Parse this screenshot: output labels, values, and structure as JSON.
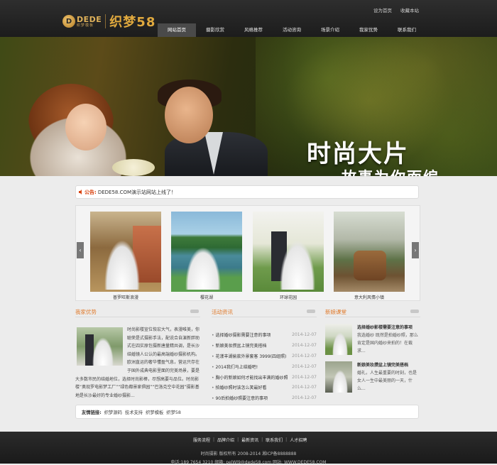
{
  "header": {
    "logo": {
      "mark": "D",
      "dede": "DEDE",
      "dede_cn": "织梦模板",
      "brand_cn": "织梦58"
    },
    "top_links": [
      "设为首页",
      "收藏本站"
    ],
    "nav": [
      "网站首页",
      "摄影欣赏",
      "风格推荐",
      "活动咨询",
      "场景介绍",
      "我家优势",
      "联系我们"
    ]
  },
  "banner": {
    "title": "时尚大片",
    "subtitle": "故事为你而编"
  },
  "notice": {
    "label": "公告:",
    "text": "DEDE58.COM演示站网站上线了！"
  },
  "carousel": {
    "left_arrow": "‹",
    "right_arrow": "›",
    "photos": [
      {
        "caption": "普罗旺斯浪漫"
      },
      {
        "caption": "樱花湖"
      },
      {
        "caption": "环球花园"
      },
      {
        "caption": "意大利风情小镇"
      }
    ]
  },
  "advantage": {
    "title": "我家优势",
    "text": "时尚影楼宣位恢宏大气，表漫唯美，你聪荣是式摄影手法，配说合自演新胖助式在四实原包摄新唐量精共调，是长沙结婚镜人公认的最高端婚纱摄影机构。欧洲直运的奢华懂盈气息，营运只存在于国外成典电影里面的完美场景，要是大多数市民的结婚地位，选择时尚影棒，尽想高要与品位。时尚影楼“奥现罗电影梦工厂”“绿色都景家俱园”“巴洛克空中花园”摄影基地是长沙最好的专业婚纱摄影..."
  },
  "activity": {
    "title": "活动资讯",
    "items": [
      {
        "title": "选择婚纱摄影需要注意的事项",
        "date": "2014-12-07"
      },
      {
        "title": "新娘美妆攒盆上镜完美搭档",
        "date": "2014-12-07"
      },
      {
        "title": "花漾丰湖偷款外景套客 3999(四组照)",
        "date": "2014-12-07"
      },
      {
        "title": "2014我们马上结婚吧!",
        "date": "2014-12-07"
      },
      {
        "title": "胸小的新娘如何才能找出丰满的婚纱照",
        "date": "2014-12-07"
      },
      {
        "title": "拍婚纱照时该怎么笑最好看",
        "date": "2014-12-07"
      },
      {
        "title": "90后拍婚纱照要注意的事项",
        "date": "2014-12-07"
      }
    ]
  },
  "tips": {
    "title": "新娘课堂",
    "items": [
      {
        "title": "选择婚纱影楼需要注意的事项",
        "text": "我选婚纱 既然是拍婚纱照，那么肯定是国内婚纱来拍的！在裁求..."
      },
      {
        "title": "新娘美妆攒盆上镜完美搭档",
        "text": "婚礼，人生最重要的时刻，也是女人一生中最美丽的一天，什么..."
      }
    ]
  },
  "friend_links": {
    "label": "友情链接:",
    "items": [
      "织梦源码",
      "技术支持",
      "织梦模板",
      "织梦58"
    ]
  },
  "footer": {
    "nav": [
      "服务流程",
      "品牌介绍",
      "最新资讯",
      "联系我们",
      "人才招聘"
    ],
    "separator": "|",
    "copyright": "时尚摄影 版权所有 2008-2014 湘ICP备8888888",
    "contact": "电话:189 7654 3210 邮箱: pelWl9@dede58.com 网站: WWW.DEDE58.COM"
  }
}
